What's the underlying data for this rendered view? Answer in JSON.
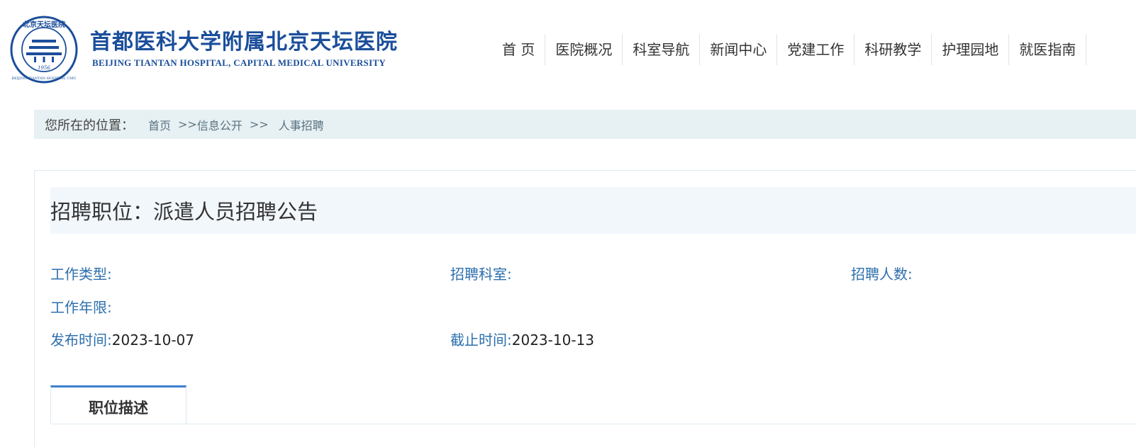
{
  "header": {
    "seal_text": [
      "北京天坛医院",
      "BEIJING TIANTAN HOSPITAL CMU",
      "1956"
    ],
    "logo_cn": "首都医科大学附属北京天坛医院",
    "logo_en": "BEIJING TIANTAN HOSPITAL, CAPITAL MEDICAL UNIVERSITY",
    "brand_color": "#1b4e9b"
  },
  "nav": {
    "items": [
      {
        "label": "首 页"
      },
      {
        "label": "医院概况"
      },
      {
        "label": "科室导航"
      },
      {
        "label": "新闻中心"
      },
      {
        "label": "党建工作"
      },
      {
        "label": "科研教学"
      },
      {
        "label": "护理园地"
      },
      {
        "label": "就医指南"
      }
    ]
  },
  "breadcrumb": {
    "label": "您所在的位置：",
    "home": "首页",
    "sep1": ">>",
    "section": "信息公开",
    "sep2": ">>",
    "current": "人事招聘"
  },
  "job": {
    "title": "招聘职位：派遣人员招聘公告",
    "work_type_label": "工作类型:",
    "work_type_value": "",
    "dept_label": "招聘科室:",
    "dept_value": "",
    "count_label": "招聘人数:",
    "count_value": "",
    "years_label": "工作年限:",
    "years_value": "",
    "publish_label": "发布时间:",
    "publish_value": "2023-10-07",
    "deadline_label": "截止时间:",
    "deadline_value": "2023-10-13"
  },
  "tabs": {
    "active_label": "职位描述"
  },
  "colors": {
    "label_blue": "#2c6fad",
    "tab_accent": "#3b7fce",
    "breadcrumb_bg": "#e7f0f3",
    "title_bg": "#f2f7fc"
  }
}
